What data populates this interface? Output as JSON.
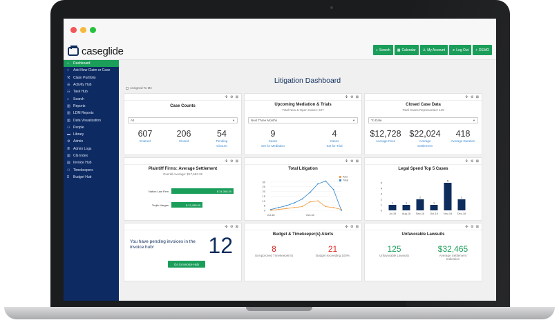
{
  "app": {
    "logo_text": "caseglide"
  },
  "nav": [
    {
      "label": "Search",
      "icon": "search-icon"
    },
    {
      "label": "Calendar",
      "icon": "calendar-icon"
    },
    {
      "label": "My Account",
      "icon": "user-icon"
    },
    {
      "label": "Log Out",
      "icon": "logout-icon"
    },
    {
      "label": "DEMO",
      "icon": "plus-icon"
    }
  ],
  "sidebar": [
    {
      "label": "Dashboard",
      "icon": "home-icon",
      "active": true
    },
    {
      "label": "Add New Claim or Case",
      "icon": "plus-icon"
    },
    {
      "label": "Claim Portfolio",
      "icon": "gavel-icon"
    },
    {
      "label": "Activity Hub",
      "icon": "list-icon"
    },
    {
      "label": "Task Hub",
      "icon": "tasks-icon"
    },
    {
      "label": "Search",
      "icon": "search-icon"
    },
    {
      "label": "Reports",
      "icon": "chart-icon"
    },
    {
      "label": "LDM Reports",
      "icon": "chart-icon"
    },
    {
      "label": "Data Visualization",
      "icon": "chart-icon"
    },
    {
      "label": "People",
      "icon": "people-icon"
    },
    {
      "label": "Library",
      "icon": "folder-icon"
    },
    {
      "label": "Admin",
      "icon": "gear-icon"
    },
    {
      "label": "Admin Logs",
      "icon": "log-icon"
    },
    {
      "label": "CG Index",
      "icon": "chart-icon"
    },
    {
      "label": "Invoice Hub",
      "icon": "invoice-icon"
    },
    {
      "label": "Timekeepers",
      "icon": "people-icon"
    },
    {
      "label": "Budget Hub",
      "icon": "dollar-icon"
    }
  ],
  "page": {
    "title": "Litigation Dashboard",
    "assigned_label": "Assigned To Me"
  },
  "tools": "✣ ⚙ ⊠",
  "case_counts": {
    "title": "Case Counts",
    "filter": "All",
    "stats": [
      {
        "num": "607",
        "label": "Entered"
      },
      {
        "num": "206",
        "label": "Closed"
      },
      {
        "num": "54",
        "label": "Pending Closure"
      }
    ]
  },
  "mediation": {
    "title": "Upcoming Mediation & Trials",
    "subtitle": "Total New & Open Cases: 347",
    "filter": "Next Three Months",
    "stats": [
      {
        "num": "9",
        "label1": "Cases",
        "label2": "Set for Mediation"
      },
      {
        "num": "4",
        "label1": "Cases",
        "label2": "Set for Trial"
      }
    ]
  },
  "closed_case": {
    "title": "Closed Case Data",
    "subtitle": "Total Cases Represented: 145",
    "filter": "To Date",
    "stats": [
      {
        "num": "$12,728",
        "label": "Average Fees"
      },
      {
        "num": "$22,024",
        "label": "Average Settlement"
      },
      {
        "num": "418",
        "label": "Average Duration"
      }
    ]
  },
  "plaintiff": {
    "title": "Plaintiff Firms: Average Settlement",
    "subtitle": "Overall Average: $17,683.39",
    "bars": [
      {
        "label": "Nation Law Firm",
        "value": 24308,
        "display": "$ 24,308.30"
      },
      {
        "label": "Trujilo Vargas",
        "value": 12185,
        "display": "$ 12,185.00"
      }
    ]
  },
  "chart_data": [
    {
      "type": "line",
      "title": "Total Litigation",
      "categories": [
        "Jul-18",
        "",
        "",
        "",
        "",
        "Oct-18",
        "",
        "",
        "",
        ""
      ],
      "ylim": [
        0,
        35
      ],
      "yticks": [
        0,
        5,
        10,
        15,
        20,
        25,
        30
      ],
      "legend": "top-right",
      "series": [
        {
          "name": "Add",
          "color": "#f2a24a",
          "values": [
            0,
            1,
            2,
            3,
            4,
            9,
            10,
            4,
            3,
            1
          ]
        },
        {
          "name": "Total",
          "color": "#3b8bd0",
          "values": [
            1,
            3,
            5,
            8,
            12,
            19,
            28,
            31,
            22,
            0
          ]
        }
      ]
    },
    {
      "type": "bar",
      "title": "Legal Spend Top 5 Cases",
      "categories": [
        "Jul-18",
        "Aug-18",
        "Sep-18",
        "Oct-18",
        "Nov-18",
        "Dec-18"
      ],
      "values": [
        1,
        1,
        2,
        1,
        5,
        2
      ],
      "ylim": [
        0,
        6
      ],
      "yticks": [
        0,
        1,
        2,
        3,
        4,
        5
      ],
      "color": "#0e2c5c"
    }
  ],
  "invoice": {
    "message": "You have pending invoices in the invoice hub!",
    "count": "12",
    "button": "Go to Invoice Hub"
  },
  "alerts": {
    "title": "Budget & Timekeeper(s) Alerts",
    "stats": [
      {
        "num": "8",
        "label": "UnApproved Timekeeper(s)"
      },
      {
        "num": "21",
        "label": "Budget exceeding 100%"
      }
    ]
  },
  "unfavorable": {
    "title": "Unfavorable Lawsuits",
    "stats": [
      {
        "num": "125",
        "label": "Unfavorable Lawsuits"
      },
      {
        "num": "$32,465",
        "label": "Average Settlement Indication"
      }
    ]
  }
}
